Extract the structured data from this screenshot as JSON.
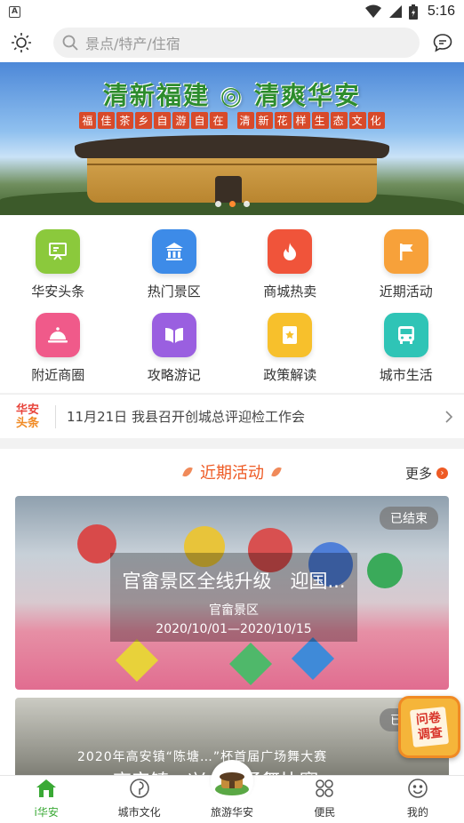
{
  "status_bar": {
    "time": "5:16",
    "app_badge": "A"
  },
  "search": {
    "placeholder": "景点/特产/住宿"
  },
  "banner": {
    "title": "清新福建 ◎ 清爽华安",
    "subtitle": [
      "福",
      "佳",
      "茶",
      "乡",
      "自",
      "游",
      "自",
      "在",
      "清",
      "新",
      "花",
      "样",
      "生",
      "态",
      "文",
      "化"
    ],
    "slide_count": 3,
    "active_slide": 1
  },
  "grid": [
    {
      "label": "华安头条",
      "icon": "news-board-icon",
      "color": "#8bc93c"
    },
    {
      "label": "热门景区",
      "icon": "temple-icon",
      "color": "#3d8be8"
    },
    {
      "label": "商城热卖",
      "icon": "flame-icon",
      "color": "#f0543a"
    },
    {
      "label": "近期活动",
      "icon": "flag-icon",
      "color": "#f7a13a"
    },
    {
      "label": "附近商圈",
      "icon": "food-cloche-icon",
      "color": "#f05a8a"
    },
    {
      "label": "攻略游记",
      "icon": "book-icon",
      "color": "#9a5fe0"
    },
    {
      "label": "政策解读",
      "icon": "document-star-icon",
      "color": "#f7c02c"
    },
    {
      "label": "城市生活",
      "icon": "bus-icon",
      "color": "#2fc4b6"
    }
  ],
  "ticker": {
    "tag_top": "华安",
    "tag_bottom": "头条",
    "text": "11月21日 我县召开创城总评迎检工作会"
  },
  "activities": {
    "title": "近期活动",
    "more": "更多",
    "cards": [
      {
        "status": "已结束",
        "title": "官畲景区全线升级　迎国...",
        "place": "官畲景区",
        "date": "2020/10/01—2020/10/15"
      },
      {
        "status": "已结束",
        "title": "高安镇…兴…广场舞比赛",
        "photo_text": "2020年高安镇“陈塘…”杯首届广场舞大赛"
      }
    ]
  },
  "survey": {
    "line1": "问卷",
    "line2": "调查"
  },
  "bottom_nav": [
    {
      "label": "i华安",
      "icon": "home-icon",
      "active": true
    },
    {
      "label": "城市文化",
      "icon": "compass-icon",
      "active": false
    },
    {
      "label": "旅游华安",
      "icon": "tulou-icon",
      "active": false
    },
    {
      "label": "便民",
      "icon": "grid-icon",
      "active": false
    },
    {
      "label": "我的",
      "icon": "smiley-icon",
      "active": false
    }
  ]
}
